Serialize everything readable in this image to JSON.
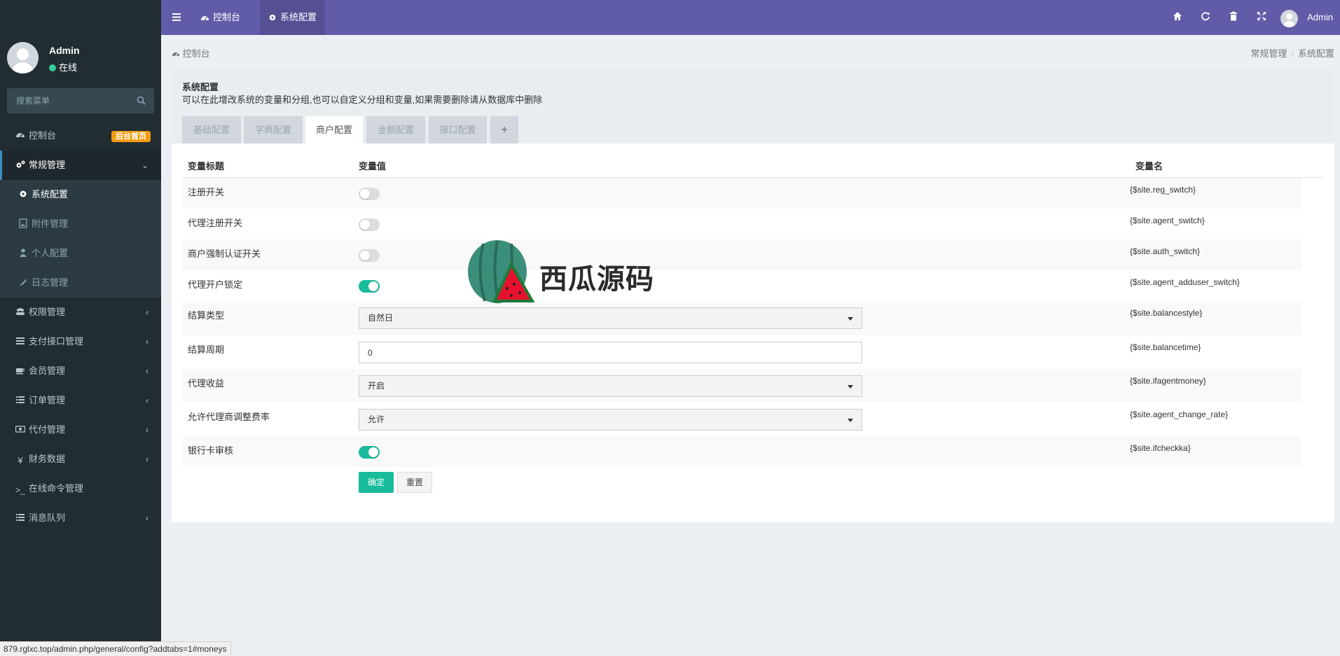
{
  "user": {
    "name": "Admin",
    "status": "在线"
  },
  "sidebar": {
    "search_placeholder": "搜索菜单",
    "items": [
      {
        "label": "控制台",
        "icon": "dashboard-icon",
        "badge": "后台首页"
      },
      {
        "label": "常规管理",
        "icon": "cogs-icon",
        "expanded": true
      },
      {
        "label": "系统配置",
        "icon": "gear-icon",
        "sub": true,
        "current": true
      },
      {
        "label": "附件管理",
        "icon": "file-image-icon",
        "sub": true
      },
      {
        "label": "个人配置",
        "icon": "user-icon",
        "sub": true
      },
      {
        "label": "日志管理",
        "icon": "rocket-icon",
        "sub": true
      },
      {
        "label": "权限管理",
        "icon": "group-icon"
      },
      {
        "label": "支付接口管理",
        "icon": "list-icon"
      },
      {
        "label": "会员管理",
        "icon": "coffee-icon"
      },
      {
        "label": "订单管理",
        "icon": "list-icon"
      },
      {
        "label": "代付管理",
        "icon": "money-icon"
      },
      {
        "label": "财务数据",
        "icon": "yen-icon"
      },
      {
        "label": "在线命令管理",
        "icon": "terminal-icon"
      },
      {
        "label": "消息队列",
        "icon": "list-icon"
      }
    ]
  },
  "header": {
    "tabs": [
      {
        "label": "控制台",
        "icon": "dashboard-icon"
      },
      {
        "label": "系统配置",
        "icon": "gear-icon",
        "current": true
      }
    ],
    "user": "Admin",
    "icons": [
      "home-icon",
      "refresh-icon",
      "trash-icon",
      "fullscreen-icon"
    ]
  },
  "breadcrumb": {
    "left": "控制台",
    "right": [
      "常规管理",
      "系统配置"
    ]
  },
  "panel": {
    "title": "系统配置",
    "description": "可以在此增改系统的变量和分组,也可以自定义分组和变量,如果需要删除请从数据库中删除",
    "tabs": [
      "基础配置",
      "字典配置",
      "商户配置",
      "金额配置",
      "接口配置",
      "+"
    ],
    "active_tab": "商户配置",
    "columns": [
      "变量标题",
      "变量值",
      "变量名"
    ],
    "rows": [
      {
        "label": "注册开关",
        "type": "switch",
        "on": false,
        "name": "{$site.reg_switch}"
      },
      {
        "label": "代理注册开关",
        "type": "switch",
        "on": false,
        "name": "{$site.agent_switch}"
      },
      {
        "label": "商户强制认证开关",
        "type": "switch",
        "on": false,
        "name": "{$site.auth_switch}"
      },
      {
        "label": "代理开户锁定",
        "type": "switch",
        "on": true,
        "name": "{$site.agent_adduser_switch}"
      },
      {
        "label": "结算类型",
        "type": "select",
        "value": "自然日",
        "name": "{$site.balancestyle}"
      },
      {
        "label": "结算周期",
        "type": "input",
        "value": "0",
        "name": "{$site.balancetime}"
      },
      {
        "label": "代理收益",
        "type": "select",
        "value": "开启",
        "name": "{$site.ifagentmoney}"
      },
      {
        "label": "允许代理商调整费率",
        "type": "select",
        "value": "允许",
        "name": "{$site.agent_change_rate}"
      },
      {
        "label": "银行卡审核",
        "type": "switch",
        "on": true,
        "name": "{$site.ifcheckka}"
      }
    ],
    "buttons": {
      "submit": "确定",
      "reset": "重置"
    }
  },
  "watermark": "西瓜源码",
  "status_url": "879.rglxc.top/admin.php/general/config?addtabs=1#moneys",
  "colors": {
    "header": "#605ca8",
    "sidebar": "#222d32",
    "accent": "#18bc9c",
    "badge": "#f39c12"
  }
}
